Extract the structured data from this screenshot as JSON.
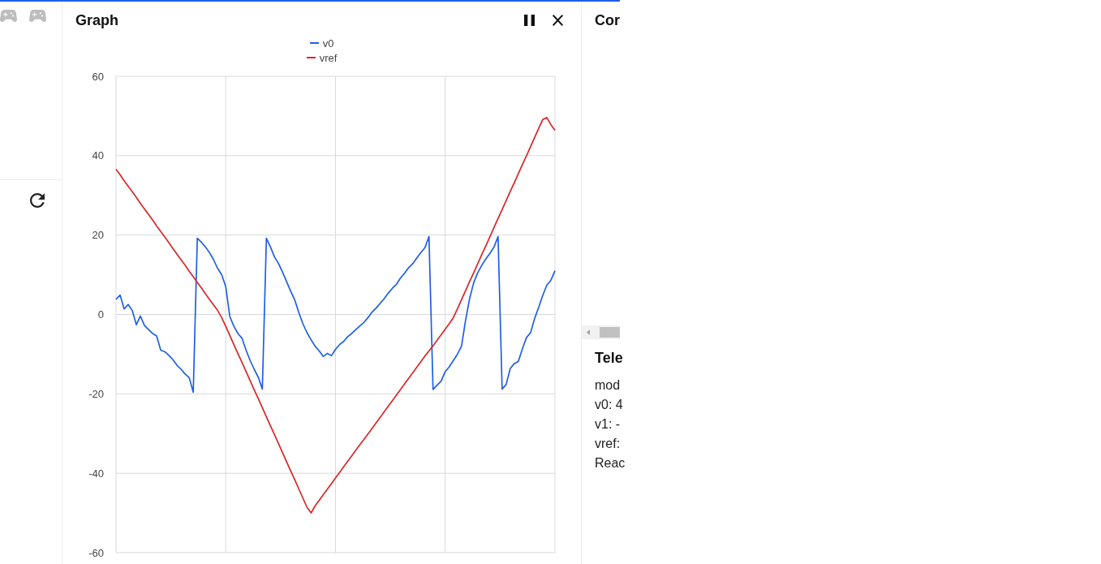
{
  "graph_panel": {
    "title": "Graph",
    "chart_data": {
      "type": "line",
      "grid": true,
      "ylim": [
        -60,
        60
      ],
      "yticks": [
        -60,
        -40,
        -20,
        0,
        20,
        40,
        60
      ],
      "series": [
        {
          "name": "v0",
          "color": "#1f5fe6",
          "values": [
            3.8,
            4.9,
            1.4,
            2.5,
            1.0,
            -2.6,
            -0.4,
            -2.8,
            -3.8,
            -4.8,
            -5.4,
            -9.0,
            -9.4,
            -10.3,
            -11.4,
            -12.8,
            -13.8,
            -15.0,
            -15.9,
            -19.6,
            19.2,
            18.2,
            17.0,
            15.6,
            13.8,
            11.6,
            10.0,
            7.0,
            -0.5,
            -3.0,
            -4.8,
            -6.0,
            -9.0,
            -11.6,
            -13.8,
            -15.8,
            -18.8,
            19.2,
            17.0,
            14.5,
            12.8,
            10.6,
            8.2,
            5.8,
            3.6,
            0.4,
            -2.4,
            -4.6,
            -6.4,
            -8.0,
            -9.2,
            -10.6,
            -9.8,
            -10.4,
            -8.8,
            -7.6,
            -6.8,
            -5.6,
            -4.8,
            -3.8,
            -2.9,
            -2.0,
            -0.8,
            0.6,
            1.6,
            2.8,
            4.0,
            5.4,
            6.6,
            7.6,
            9.2,
            10.4,
            11.8,
            12.8,
            14.2,
            15.6,
            16.8,
            19.6,
            -18.9,
            -17.8,
            -16.8,
            -14.4,
            -13.2,
            -11.6,
            -10.0,
            -8.0,
            -1.5,
            4.0,
            8.0,
            10.5,
            12.4,
            14.0,
            15.4,
            17.0,
            19.6,
            -18.8,
            -17.6,
            -13.6,
            -12.4,
            -11.8,
            -8.6,
            -5.8,
            -4.6,
            -1.0,
            1.8,
            4.8,
            7.4,
            8.6,
            11.0
          ]
        },
        {
          "name": "vref",
          "color": "#dc2626",
          "values": [
            36.6,
            35.2,
            33.7,
            32.3,
            30.9,
            29.5,
            28.0,
            26.6,
            25.2,
            23.8,
            22.3,
            20.9,
            19.5,
            18.1,
            16.6,
            15.2,
            13.8,
            12.4,
            10.9,
            9.5,
            8.1,
            6.7,
            5.2,
            3.8,
            2.4,
            1.0,
            -0.8,
            -3.0,
            -5.3,
            -7.6,
            -9.9,
            -12.1,
            -14.4,
            -16.7,
            -19.0,
            -21.2,
            -23.5,
            -25.8,
            -28.1,
            -30.3,
            -32.6,
            -34.9,
            -37.2,
            -39.5,
            -41.7,
            -44.0,
            -46.3,
            -48.6,
            -50.0,
            -48.2,
            -46.8,
            -45.4,
            -44.0,
            -42.6,
            -41.2,
            -39.8,
            -38.4,
            -37.0,
            -35.6,
            -34.2,
            -32.8,
            -31.5,
            -30.1,
            -28.7,
            -27.3,
            -25.9,
            -24.5,
            -23.1,
            -21.7,
            -20.3,
            -18.9,
            -17.5,
            -16.1,
            -14.7,
            -13.3,
            -11.9,
            -10.5,
            -9.2,
            -7.9,
            -6.5,
            -5.1,
            -3.7,
            -2.3,
            -0.8,
            1.4,
            3.7,
            6.0,
            8.3,
            10.5,
            12.8,
            15.1,
            17.3,
            19.6,
            21.9,
            24.2,
            26.4,
            28.7,
            31.0,
            33.2,
            35.5,
            37.8,
            40.0,
            42.3,
            44.6,
            46.9,
            49.1,
            49.6,
            47.8,
            46.4
          ]
        }
      ]
    }
  },
  "controls_panel": {
    "title": "Cor"
  },
  "telemetry": {
    "title": "Tele",
    "lines": [
      "mod",
      "v0: 4",
      "v1: -",
      "vref:",
      "Reac"
    ]
  }
}
